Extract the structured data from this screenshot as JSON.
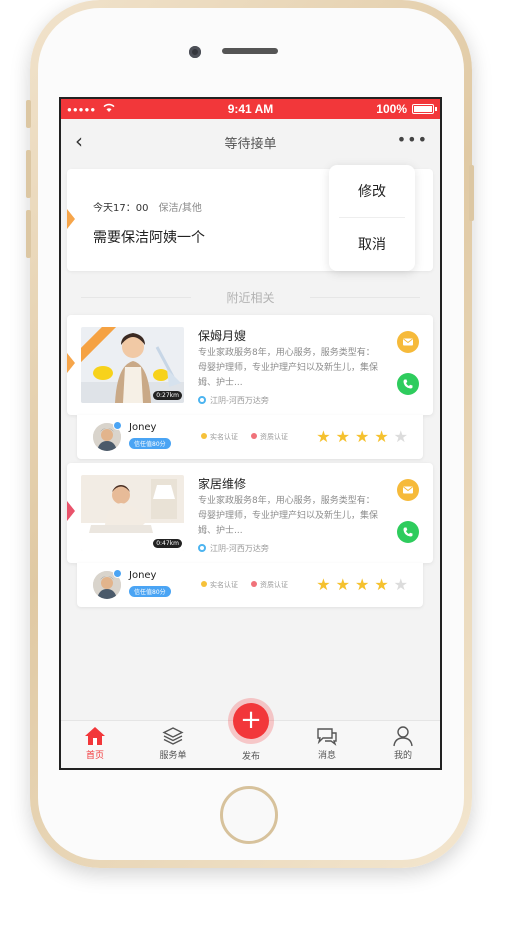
{
  "status_bar": {
    "signal": "●●●●●",
    "time": "9:41 AM",
    "battery": "100%"
  },
  "navbar": {
    "back": "‹",
    "title": "等待接单",
    "more": "•••"
  },
  "request": {
    "time": "今天17：00",
    "category": "保洁/其他",
    "title": "需要保洁阿姨一个"
  },
  "popup_menu": {
    "edit": "修改",
    "cancel": "取消"
  },
  "section": {
    "nearby": "附近相关"
  },
  "services": [
    {
      "title": "保姆月嫂",
      "description": "专业家政服务8年，用心服务，服务类型有：母婴护理师，专业护理产妇以及新生儿，集保姆、护士...",
      "location": "江阴-河西万达旁",
      "duration": "0:27km",
      "accent": "#f6a54a",
      "agent": {
        "name": "Joney",
        "trust": "信任值80分",
        "cert_real": "实名认证",
        "cert_qual": "资质认证",
        "rating": 4
      }
    },
    {
      "title": "家居维修",
      "description": "专业家政服务8年，用心服务，服务类型有：母婴护理师，专业护理产妇以及新生儿，集保姆、护士...",
      "location": "江阴-河西万达旁",
      "duration": "0:47km",
      "accent": "#e9536b",
      "agent": {
        "name": "Joney",
        "trust": "信任值80分",
        "cert_real": "实名认证",
        "cert_qual": "资质认证",
        "rating": 4
      }
    }
  ],
  "tabbar": {
    "home": "首页",
    "orders": "服务单",
    "publish": "发布",
    "messages": "消息",
    "mine": "我的"
  },
  "colors": {
    "brand": "#f2373a",
    "mail": "#f6ba3a",
    "call": "#2ecc5d",
    "star": "#f5c12e"
  },
  "icons": [
    "back-arrow-icon",
    "more-icon",
    "mail-icon",
    "phone-icon",
    "location-icon",
    "home-icon",
    "layers-icon",
    "plus-icon",
    "chat-icon",
    "user-icon"
  ]
}
